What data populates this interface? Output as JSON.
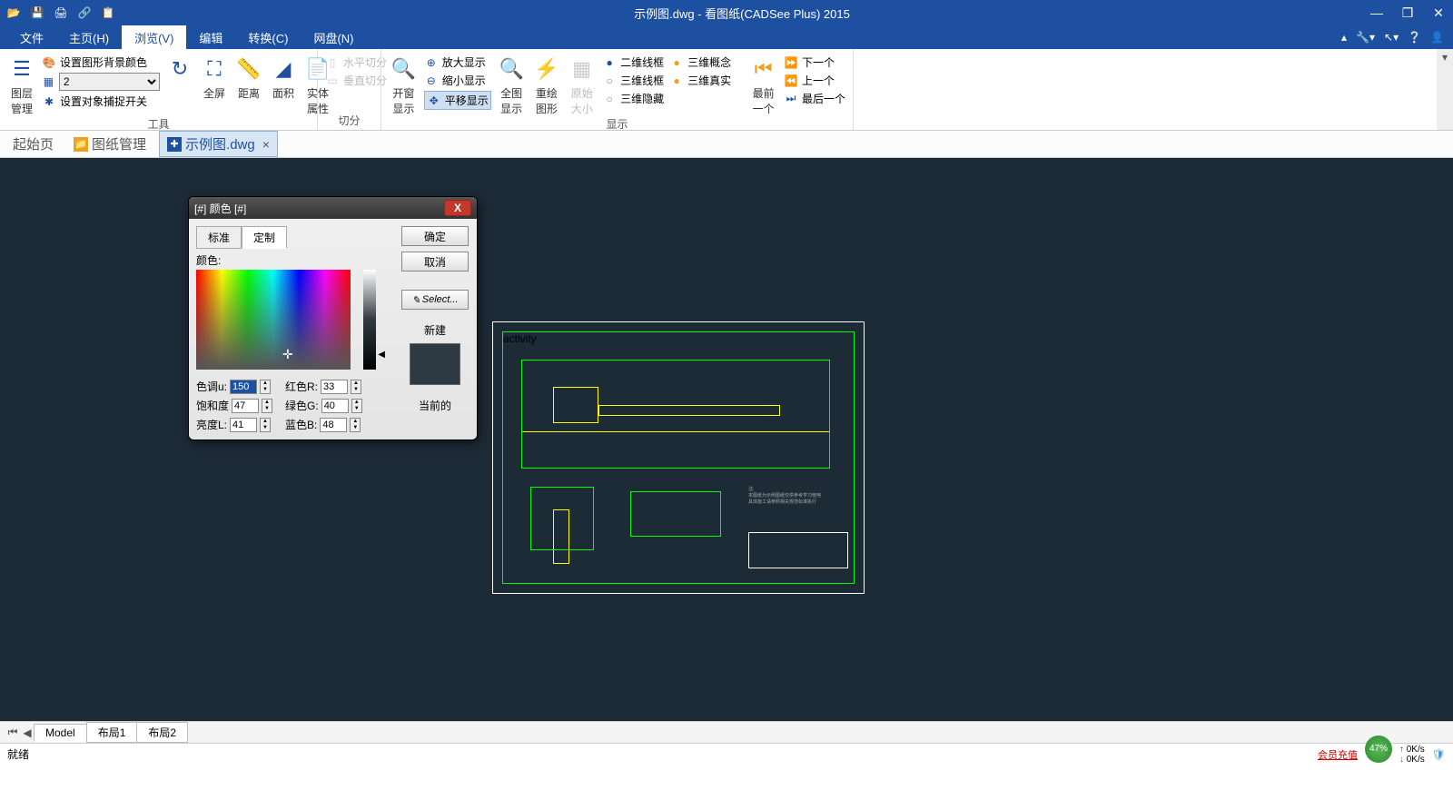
{
  "title": "示例图.dwg - 看图纸(CADSee Plus) 2015",
  "menubar": [
    "文件",
    "主页(H)",
    "浏览(V)",
    "编辑",
    "转换(C)",
    "网盘(N)"
  ],
  "menubar_active": 2,
  "ribbon": {
    "groups": [
      {
        "label": "工具",
        "bigButtons": [
          {
            "icon": "☰",
            "text": "图层管理"
          }
        ],
        "smallItems": [
          {
            "icon": "🎨",
            "text": "设置图形背景颜色"
          },
          {
            "type": "combo",
            "value": "2"
          },
          {
            "icon": "✱",
            "text": "设置对象捕捉开关"
          }
        ],
        "rightBigButtons": [
          {
            "icon": "↺",
            "text": ""
          },
          {
            "icon": "⛶",
            "text": "全屏"
          },
          {
            "icon": "↔",
            "text": "距离"
          },
          {
            "icon": "▭",
            "text": "面积"
          },
          {
            "icon": "📄",
            "text": "实体属性"
          }
        ]
      },
      {
        "label": "切分",
        "bigButtons": [],
        "smallItems": [
          {
            "icon": "▯",
            "text": "水平切分",
            "disabled": true
          },
          {
            "icon": "▭",
            "text": "垂直切分",
            "disabled": true
          }
        ]
      },
      {
        "label": "显示",
        "bigButtons": [
          {
            "icon": "🔍",
            "text": "开窗显示"
          }
        ],
        "smallItems": [
          {
            "icon": "⊕",
            "text": "放大显示"
          },
          {
            "icon": "⊖",
            "text": "缩小显示"
          },
          {
            "icon": "✥",
            "text": "平移显示",
            "highlighted": true
          }
        ],
        "rightBigButtons": [
          {
            "icon": "🔍",
            "text": "全图显示"
          },
          {
            "icon": "⚡",
            "text": "重绘图形"
          },
          {
            "icon": "▦",
            "text": "原始大小",
            "disabled": true
          }
        ],
        "rightSmallCols": [
          [
            {
              "dot": "#1e50a2",
              "text": "二维线框"
            },
            {
              "dot": "#888",
              "text": "三维线框"
            },
            {
              "dot": "#888",
              "text": "三维隐藏"
            }
          ],
          [
            {
              "dot": "#f0a020",
              "text": "三维概念"
            },
            {
              "dot": "#f0a020",
              "text": "三维真实"
            }
          ]
        ],
        "nav": {
          "first": "最前一个",
          "items": [
            "下一个",
            "上一个",
            "最后一个"
          ]
        }
      }
    ]
  },
  "doctabs": {
    "start": "起始页",
    "mgmt": "图纸管理",
    "file": "示例图.dwg"
  },
  "dialog": {
    "title": "[#] 颜色 [#]",
    "tabs": [
      "标准",
      "定制"
    ],
    "active_tab": 1,
    "color_label": "颜色:",
    "hue": {
      "label": "色调u:",
      "value": "150"
    },
    "sat": {
      "label": "饱和度",
      "value": "47"
    },
    "lum": {
      "label": "亮度L:",
      "value": "41"
    },
    "red": {
      "label": "红色R:",
      "value": "33"
    },
    "green": {
      "label": "绿色G:",
      "value": "40"
    },
    "blue": {
      "label": "蓝色B:",
      "value": "48"
    },
    "ok": "确定",
    "cancel": "取消",
    "select": "Select...",
    "new": "新建",
    "current": "当前的"
  },
  "bottom_tabs": [
    "Model",
    "布局1",
    "布局2"
  ],
  "status": {
    "ready": "就绪",
    "member": "会员充值",
    "pct": "47%",
    "up": "0K/s",
    "down": "0K/s"
  }
}
